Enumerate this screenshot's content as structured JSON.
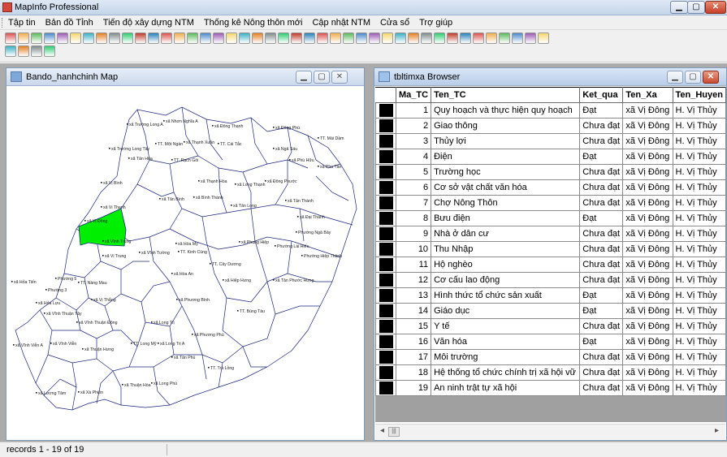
{
  "app": {
    "title": "MapInfo Professional"
  },
  "menu": [
    "Tập tin",
    "Bản đồ Tỉnh",
    "Tiến độ xây dựng NTM",
    "Thống kê Nông thôn mới",
    "Cập nhật NTM",
    "Cửa sổ",
    "Trợ giúp"
  ],
  "map_window": {
    "title": "Bando_hanhchinh Map",
    "highlight_color": "#00ee00",
    "labels": [
      "xã Trường Long A",
      "xã Nhơn Nghĩa A",
      "xã Đông Thạnh",
      "xã Đông Phú",
      "TT. Mái Dầm",
      "xã Trường Long Tây",
      "TT. Một Ngàn",
      "xã Thạnh Xuân",
      "TT. Cái Tắc",
      "xã Ngã Sáu",
      "xã Tân Hòa",
      "TT. Rạch Gòi",
      "xã Phú Hữu",
      "xã Phú Tân",
      "xã Vị Bình",
      "xã Thạnh Hòa",
      "xã Long Thạnh",
      "xã Đông Phước",
      "xã Tân Bình",
      "xã Bình Thành",
      "xã Tân Long",
      "xã Tân Thành",
      "xã Vị Thanh",
      "xã Vị Đông",
      "xã Đại Thành",
      "xã Vĩnh Trung",
      "xã Hòa Mỹ",
      "xã Phụng Hiệp",
      "Phường Ngã Bảy",
      "xã Vĩnh Tường",
      "TT. Kinh Cùng",
      "Phường Lái Hiếu",
      "Phường Hiệp Thành",
      "xã Vị Trung",
      "TT. Cây Dương",
      "xã Hỏa Tiến",
      "Phường 5",
      "xã Hòa An",
      "xã Hiệp Hưng",
      "xã Tân Phước Hưng",
      "Phường 3",
      "TT. Nàng Mau",
      "xã Vị Thắng",
      "xã Phương Bình",
      "xã Hỏa Lựu",
      "TT. Búng Tàu",
      "xã Vĩnh Thuận Tây",
      "xã Vĩnh Thuận Đông",
      "xã Long Trị",
      "xã Phương Phú",
      "xã Vĩnh Viễn A",
      "xã Vĩnh Viễn",
      "TT. Long Mỹ",
      "xã Long Trị A",
      "xã Thuận Hưng",
      "xã Tân Phú",
      "TT. Trà Lồng",
      "xã Long Phú",
      "xã Lương Tâm",
      "xã Thuận Hòa",
      "xã Xà Phiên"
    ]
  },
  "browser_window": {
    "title": "tbltimxa Browser",
    "columns": [
      "Ma_TC",
      "Ten_TC",
      "Ket_qua",
      "Ten_Xa",
      "Ten_Huyen"
    ],
    "rows": [
      [
        "1",
        "Quy hoạch và thực hiện quy hoạch",
        "Đạt",
        "xã Vị Đông",
        "H. Vị Thủy"
      ],
      [
        "2",
        "Giao thông",
        "Chưa đạt",
        "xã Vị Đông",
        "H. Vị Thủy"
      ],
      [
        "3",
        "Thủy lợi",
        "Chưa đạt",
        "xã Vị Đông",
        "H. Vị Thủy"
      ],
      [
        "4",
        "Điện",
        "Đạt",
        "xã Vị Đông",
        "H. Vị Thủy"
      ],
      [
        "5",
        "Trường học",
        "Chưa đạt",
        "xã Vị Đông",
        "H. Vị Thủy"
      ],
      [
        "6",
        "Cơ sở vật chất văn hóa",
        "Chưa đạt",
        "xã Vị Đông",
        "H. Vị Thủy"
      ],
      [
        "7",
        "Chợ Nông Thôn",
        "Chưa đạt",
        "xã Vị Đông",
        "H. Vị Thủy"
      ],
      [
        "8",
        "Bưu điện",
        "Đạt",
        "xã Vị Đông",
        "H. Vị Thủy"
      ],
      [
        "9",
        "Nhà ở dân cư",
        "Chưa đạt",
        "xã Vị Đông",
        "H. Vị Thủy"
      ],
      [
        "10",
        "Thu Nhập",
        "Chưa đạt",
        "xã Vị Đông",
        "H. Vị Thủy"
      ],
      [
        "11",
        "Hộ nghèo",
        "Chưa đạt",
        "xã Vị Đông",
        "H. Vị Thủy"
      ],
      [
        "12",
        "Cơ cấu lao động",
        "Chưa đạt",
        "xã Vị Đông",
        "H. Vị Thủy"
      ],
      [
        "13",
        "Hình thức tổ chức sản xuất",
        "Đạt",
        "xã Vị Đông",
        "H. Vị Thủy"
      ],
      [
        "14",
        "Giáo dục",
        "Đạt",
        "xã Vị Đông",
        "H. Vị Thủy"
      ],
      [
        "15",
        "Y tế",
        "Chưa đạt",
        "xã Vị Đông",
        "H. Vị Thủy"
      ],
      [
        "16",
        "Văn hóa",
        "Đạt",
        "xã Vị Đông",
        "H. Vị Thủy"
      ],
      [
        "17",
        "Môi trường",
        "Chưa đạt",
        "xã Vị Đông",
        "H. Vị Thủy"
      ],
      [
        "18",
        "Hệ thống tổ chức chính trị xã hội vữ",
        "Chưa đạt",
        "xã Vị Đông",
        "H. Vị Thủy"
      ],
      [
        "19",
        "An ninh trật tự xã hội",
        "Chưa đạt",
        "xã Vị Đông",
        "H. Vị Thủy"
      ]
    ]
  },
  "status": {
    "text": "records 1 - 19 of 19"
  }
}
